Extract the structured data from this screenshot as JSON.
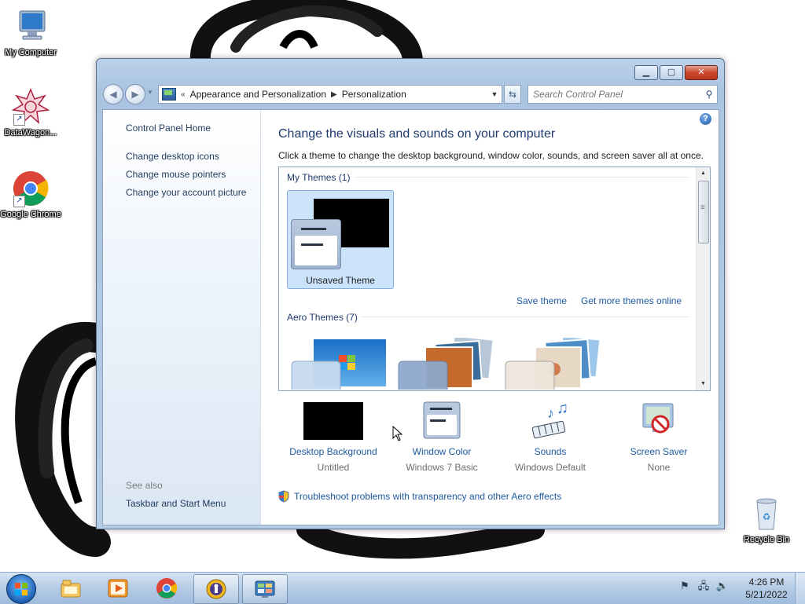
{
  "desktop": {
    "icons": [
      {
        "label": "My Computer"
      },
      {
        "label": "DataWagon..."
      },
      {
        "label": "Google Chrome"
      },
      {
        "label": "Recycle Bin"
      }
    ]
  },
  "window": {
    "caption_buttons": {
      "minimize": "▁",
      "maximize": "▢",
      "close": "✕"
    },
    "nav": {
      "back_icon": "back-arrow-icon",
      "forward_icon": "forward-arrow-icon",
      "breadcrumb_prefix": "«",
      "breadcrumbs": [
        "Appearance and Personalization",
        "Personalization"
      ],
      "search_placeholder": "Search Control Panel"
    },
    "left_pane": {
      "home": "Control Panel Home",
      "links": [
        "Change desktop icons",
        "Change mouse pointers",
        "Change your account picture"
      ],
      "see_also_label": "See also",
      "see_also_links": [
        "Taskbar and Start Menu"
      ]
    },
    "main": {
      "title": "Change the visuals and sounds on your computer",
      "subtitle": "Click a theme to change the desktop background, window color, sounds, and screen saver all at once.",
      "help": "?",
      "groups": {
        "my_themes": {
          "header": "My Themes (1)",
          "themes": [
            {
              "label": "Unsaved Theme",
              "selected": true
            }
          ]
        },
        "aero_themes": {
          "header": "Aero Themes (7)"
        }
      },
      "theme_links": {
        "save": "Save theme",
        "more": "Get more themes online"
      },
      "settings": [
        {
          "label": "Desktop Background",
          "value": "Untitled",
          "icon": "desktop-background-icon"
        },
        {
          "label": "Window Color",
          "value": "Windows 7 Basic",
          "icon": "window-color-icon"
        },
        {
          "label": "Sounds",
          "value": "Windows Default",
          "icon": "sounds-icon"
        },
        {
          "label": "Screen Saver",
          "value": "None",
          "icon": "screen-saver-icon"
        }
      ],
      "troubleshoot": "Troubleshoot problems with transparency and other Aero effects"
    }
  },
  "taskbar": {
    "buttons": [
      {
        "icon": "file-explorer-icon"
      },
      {
        "icon": "media-player-icon"
      },
      {
        "icon": "chrome-icon"
      },
      {
        "icon": "security-app-icon"
      },
      {
        "icon": "control-panel-icon",
        "active": true
      }
    ],
    "clock": {
      "time": "4:26 PM",
      "date": "5/21/2022"
    }
  }
}
